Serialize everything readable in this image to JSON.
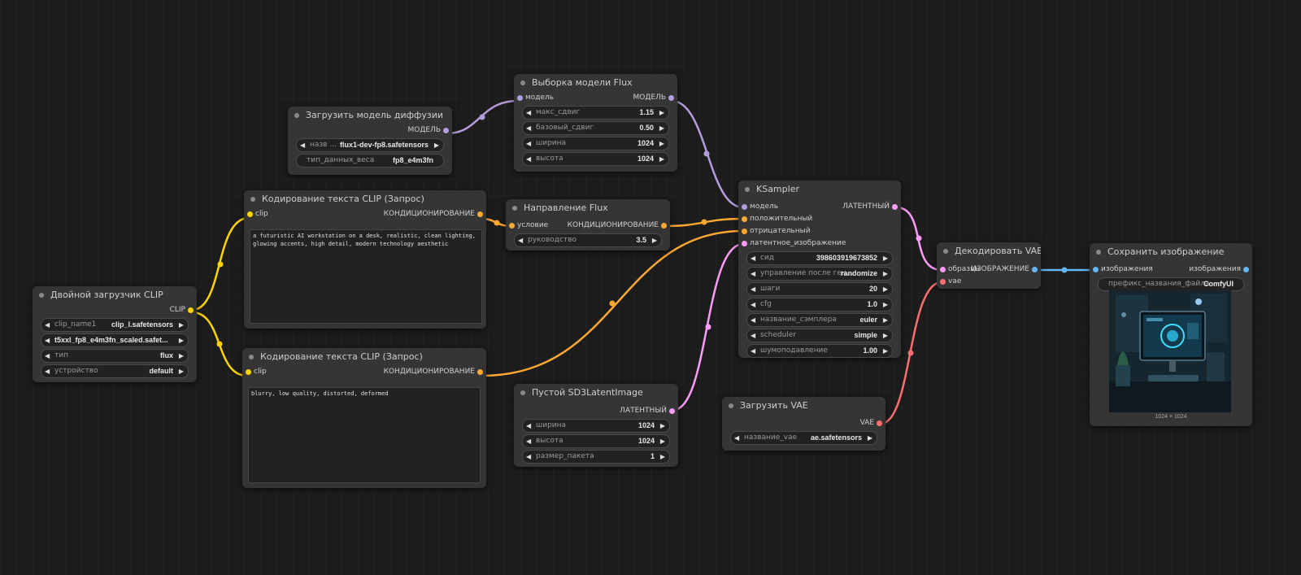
{
  "nodes": {
    "load_diffusion": {
      "title": "Загрузить модель диффузии",
      "output": "МОДЕЛЬ",
      "widgets": [
        {
          "label": "назв ...",
          "value": "flux1-dev-fp8.safetensors"
        },
        {
          "label": "тип_данных_веса",
          "value": "fp8_e4m3fn"
        }
      ]
    },
    "flux_sampling": {
      "title": "Выборка модели Flux",
      "input": "модель",
      "output": "МОДЕЛЬ",
      "widgets": [
        {
          "label": "макс_сдвиг",
          "value": "1.15"
        },
        {
          "label": "базовый_сдвиг",
          "value": "0.50"
        },
        {
          "label": "ширина",
          "value": "1024"
        },
        {
          "label": "высота",
          "value": "1024"
        }
      ]
    },
    "clip_pos": {
      "title": "Кодирование текста CLIP (Запрос)",
      "input": "clip",
      "output": "КОНДИЦИОНИРОВАНИЕ",
      "text": "a futuristic AI workstation on a desk, realistic, clean lighting, glowing accents, high detail, modern technology aesthetic"
    },
    "flux_guidance": {
      "title": "Направление Flux",
      "input": "условие",
      "output": "КОНДИЦИОНИРОВАНИЕ",
      "widgets": [
        {
          "label": "руководство",
          "value": "3.5"
        }
      ]
    },
    "dual_clip": {
      "title": "Двойной загрузчик CLIP",
      "output": "CLIP",
      "widgets": [
        {
          "label": "clip_name1",
          "value": "clip_l.safetensors"
        },
        {
          "label": "",
          "value": "t5xxl_fp8_e4m3fn_scaled.safet..."
        },
        {
          "label": "тип",
          "value": "flux"
        },
        {
          "label": "устройство",
          "value": "default"
        }
      ]
    },
    "clip_neg": {
      "title": "Кодирование текста CLIP (Запрос)",
      "input": "clip",
      "output": "КОНДИЦИОНИРОВАНИЕ",
      "text": "blurry, low quality, distorted, deformed"
    },
    "empty_latent": {
      "title": "Пустой SD3LatentImage",
      "output": "ЛАТЕНТНЫЙ",
      "widgets": [
        {
          "label": "ширина",
          "value": "1024"
        },
        {
          "label": "высота",
          "value": "1024"
        },
        {
          "label": "размер_пакета",
          "value": "1"
        }
      ]
    },
    "ksampler": {
      "title": "KSampler",
      "inputs": [
        "модель",
        "положительный",
        "отрицательный",
        "латентное_изображение"
      ],
      "output": "ЛАТЕНТНЫЙ",
      "widgets": [
        {
          "label": "сид",
          "value": "398603919673852"
        },
        {
          "label": "управление после ген...",
          "value": "randomize"
        },
        {
          "label": "шаги",
          "value": "20"
        },
        {
          "label": "cfg",
          "value": "1.0"
        },
        {
          "label": "название_сэмплера",
          "value": "euler"
        },
        {
          "label": "scheduler",
          "value": "simple"
        },
        {
          "label": "шумоподавление",
          "value": "1.00"
        }
      ]
    },
    "load_vae": {
      "title": "Загрузить VAE",
      "output": "VAE",
      "widgets": [
        {
          "label": "название_vae",
          "value": "ae.safetensors"
        }
      ]
    },
    "vae_decode": {
      "title": "Декодировать VAE",
      "inputs": [
        "образцы",
        "vae"
      ],
      "output": "ИЗОБРАЖЕНИЕ"
    },
    "save_image": {
      "title": "Сохранить изображение",
      "input": "изображения",
      "output": "изображения",
      "widgets": [
        {
          "label": "префикс_названия_файла",
          "value": "ComfyUI"
        }
      ],
      "image_size": "1024 × 1024"
    }
  },
  "colors": {
    "model": "#b39ddb",
    "clip": "#ffd500",
    "conditioning": "#ffa931",
    "latent": "#ff9cf9",
    "vae": "#ff6e6e",
    "image": "#64b5f6"
  }
}
